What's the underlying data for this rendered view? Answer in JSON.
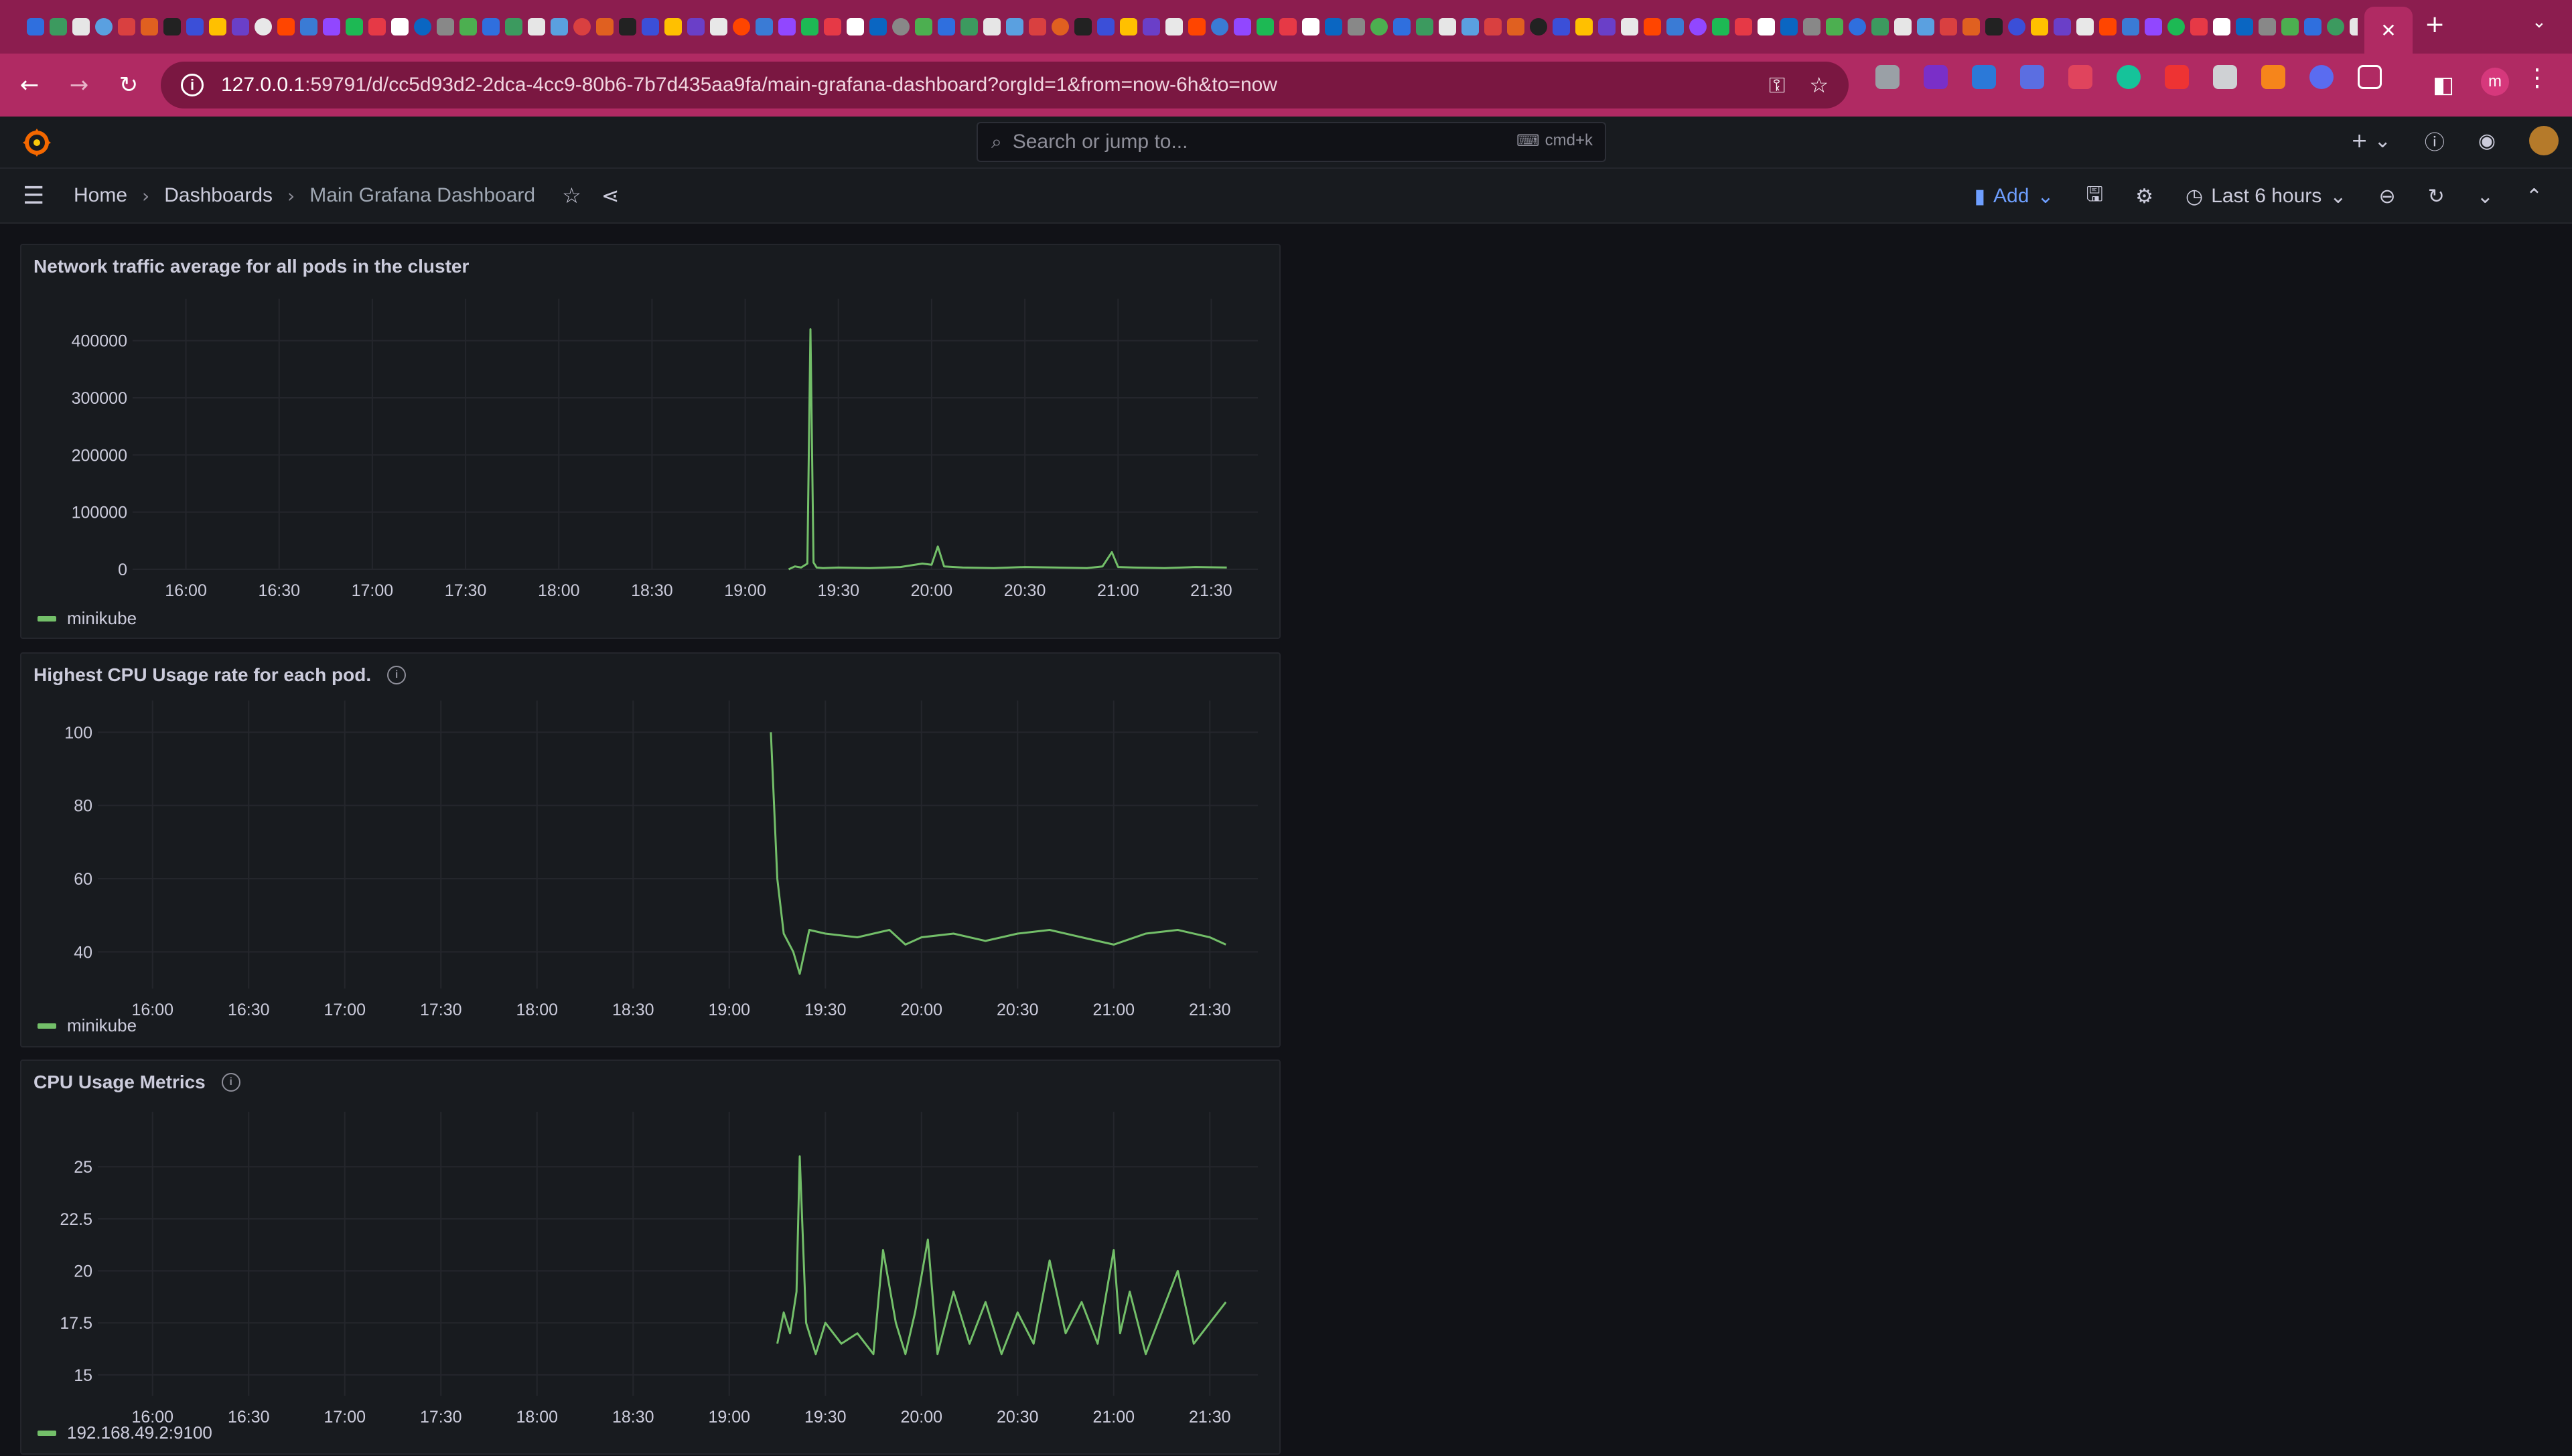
{
  "browser": {
    "url_host": "127.0.0.1",
    "url_rest": ":59791/d/cc5d93d2-2dca-4cc9-80b6-7b7d435aa9fa/main-grafana-dashboard?orgId=1&from=now-6h&to=now",
    "profile_initial": "m",
    "close_tab_glyph": "✕",
    "new_tab_glyph": "+",
    "favicon_colors": [
      "#2f6fde",
      "#3c9a5f",
      "#e6e6e6",
      "#5aa0e0",
      "#d94040",
      "#e06020",
      "#222222",
      "#3b4fd8",
      "#ffc000",
      "#6a3fc8",
      "#e8e8e8",
      "#ff4500",
      "#3a7bd5",
      "#9147ff",
      "#1db954",
      "#e63946",
      "#ffffff",
      "#0a66c2",
      "#888888",
      "#4caf50"
    ]
  },
  "grafana": {
    "search": {
      "placeholder": "Search or jump to...",
      "shortcut": "cmd+k"
    },
    "breadcrumb": [
      "Home",
      "Dashboards",
      "Main Grafana Dashboard"
    ],
    "toolbar": {
      "add_label": "Add",
      "time_range": "Last 6 hours"
    },
    "accent_color": "#73bf69",
    "panels": [
      {
        "title": "Network traffic average for all pods in the cluster",
        "has_info": false,
        "legend": "minikube"
      },
      {
        "title": "Highest CPU Usage rate for each pod.",
        "has_info": true,
        "legend": "minikube"
      },
      {
        "title": "CPU Usage Metrics",
        "has_info": true,
        "legend": "192.168.49.2:9100"
      }
    ]
  },
  "chart_data": [
    {
      "type": "line",
      "title": "Network traffic average for all pods in the cluster",
      "x_ticks": [
        "16:00",
        "16:30",
        "17:00",
        "17:30",
        "18:00",
        "18:30",
        "19:00",
        "19:30",
        "20:00",
        "20:30",
        "21:00",
        "21:30"
      ],
      "y_ticks": [
        "0",
        "100000",
        "200000",
        "300000",
        "400000"
      ],
      "ylim": [
        0,
        450000
      ],
      "xlim_minutes": [
        945,
        1305
      ],
      "grid": true,
      "legend_position": "bottom-left",
      "series": [
        {
          "name": "minikube",
          "x": [
            "19:14",
            "19:16",
            "19:18",
            "19:20",
            "19:21",
            "19:22",
            "19:23",
            "19:25",
            "19:30",
            "19:40",
            "19:50",
            "19:57",
            "20:00",
            "20:02",
            "20:04",
            "20:10",
            "20:20",
            "20:30",
            "20:40",
            "20:50",
            "20:55",
            "20:58",
            "21:00",
            "21:05",
            "21:15",
            "21:25",
            "21:35"
          ],
          "y": [
            0,
            5000,
            3000,
            10000,
            420000,
            12000,
            3000,
            2000,
            3000,
            2000,
            4000,
            10000,
            8000,
            40000,
            5000,
            3000,
            2000,
            4000,
            3000,
            2000,
            5000,
            30000,
            4000,
            3000,
            2000,
            4000,
            3000
          ]
        }
      ]
    },
    {
      "type": "line",
      "title": "Highest CPU Usage rate for each pod.",
      "x_ticks": [
        "16:00",
        "16:30",
        "17:00",
        "17:30",
        "18:00",
        "18:30",
        "19:00",
        "19:30",
        "20:00",
        "20:30",
        "21:00",
        "21:30"
      ],
      "y_ticks": [
        "40",
        "60",
        "80",
        "100"
      ],
      "ylim": [
        30,
        105
      ],
      "xlim_minutes": [
        945,
        1305
      ],
      "grid": true,
      "legend_position": "bottom-left",
      "series": [
        {
          "name": "minikube",
          "x": [
            "19:13",
            "19:15",
            "19:17",
            "19:20",
            "19:22",
            "19:25",
            "19:30",
            "19:40",
            "19:50",
            "19:55",
            "20:00",
            "20:10",
            "20:20",
            "20:30",
            "20:40",
            "20:50",
            "21:00",
            "21:10",
            "21:20",
            "21:30",
            "21:35"
          ],
          "y": [
            100,
            60,
            45,
            40,
            34,
            46,
            45,
            44,
            46,
            42,
            44,
            45,
            43,
            45,
            46,
            44,
            42,
            45,
            46,
            44,
            42
          ]
        }
      ]
    },
    {
      "type": "line",
      "title": "CPU Usage Metrics",
      "x_ticks": [
        "16:00",
        "16:30",
        "17:00",
        "17:30",
        "18:00",
        "18:30",
        "19:00",
        "19:30",
        "20:00",
        "20:30",
        "21:00",
        "21:30"
      ],
      "y_ticks": [
        "15",
        "17.5",
        "20",
        "22.5",
        "25"
      ],
      "ylim": [
        14,
        27
      ],
      "xlim_minutes": [
        945,
        1305
      ],
      "grid": true,
      "legend_position": "bottom-left",
      "series": [
        {
          "name": "192.168.49.2:9100",
          "x": [
            "19:15",
            "19:17",
            "19:19",
            "19:21",
            "19:22",
            "19:24",
            "19:27",
            "19:30",
            "19:35",
            "19:40",
            "19:45",
            "19:48",
            "19:52",
            "19:55",
            "19:58",
            "20:02",
            "20:05",
            "20:10",
            "20:15",
            "20:20",
            "20:25",
            "20:30",
            "20:35",
            "20:40",
            "20:45",
            "20:50",
            "20:55",
            "21:00",
            "21:02",
            "21:05",
            "21:10",
            "21:15",
            "21:20",
            "21:25",
            "21:30",
            "21:35"
          ],
          "y": [
            16.5,
            18,
            17,
            19,
            25.5,
            17.5,
            16,
            17.5,
            16.5,
            17,
            16,
            21,
            17.5,
            16,
            18,
            21.5,
            16,
            19,
            16.5,
            18.5,
            16,
            18,
            16.5,
            20.5,
            17,
            18.5,
            16.5,
            21,
            17,
            19,
            16,
            18,
            20,
            16.5,
            17.5,
            18.5
          ]
        }
      ]
    }
  ]
}
